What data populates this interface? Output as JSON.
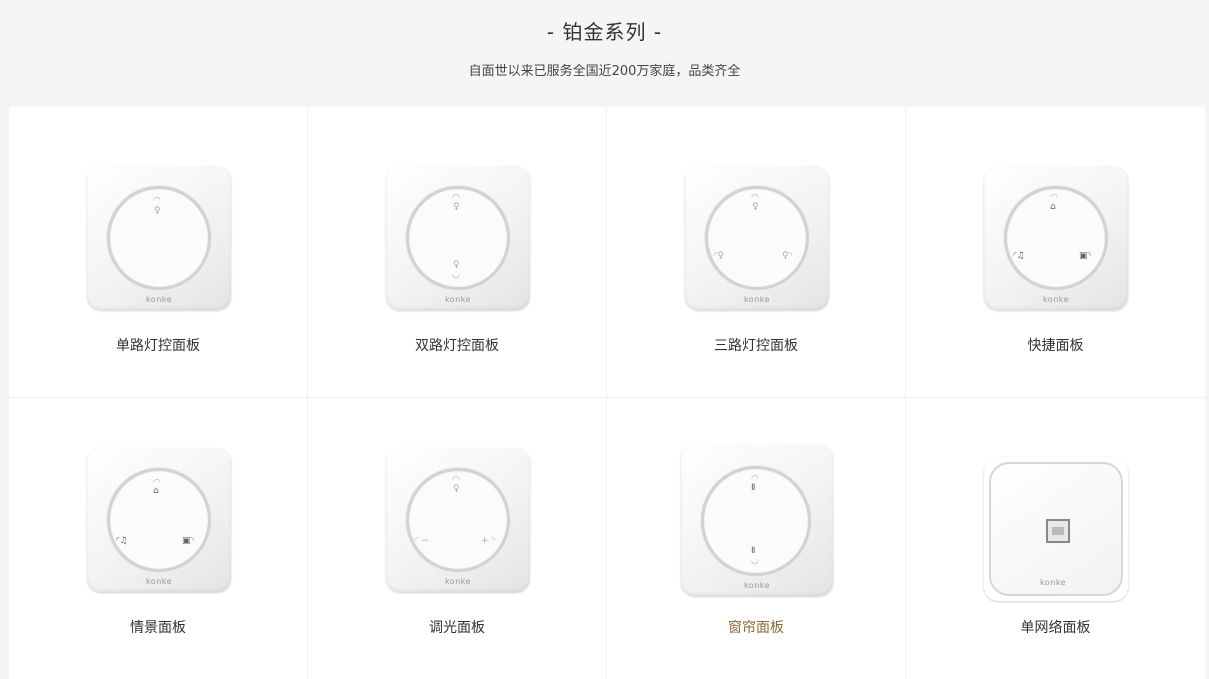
{
  "section": {
    "title": "- 铂金系列 -",
    "subtitle": "自面世以来已服务全国近200万家庭，品类齐全"
  },
  "brand": "konke",
  "products": [
    {
      "name": "单路灯控面板"
    },
    {
      "name": "双路灯控面板"
    },
    {
      "name": "三路灯控面板"
    },
    {
      "name": "快捷面板"
    },
    {
      "name": "情景面板"
    },
    {
      "name": "调光面板"
    },
    {
      "name": "窗帘面板"
    },
    {
      "name": "单网络面板"
    }
  ],
  "colors": {
    "page_bg": "#f5f5f5",
    "card_bg": "#ffffff",
    "accent_label": "#8a6a3a"
  },
  "icons": [
    "bulb-icon",
    "home-icon",
    "music-icon",
    "lock-icon",
    "minus-icon",
    "plus-icon",
    "curtain-icon",
    "network-port-icon"
  ]
}
